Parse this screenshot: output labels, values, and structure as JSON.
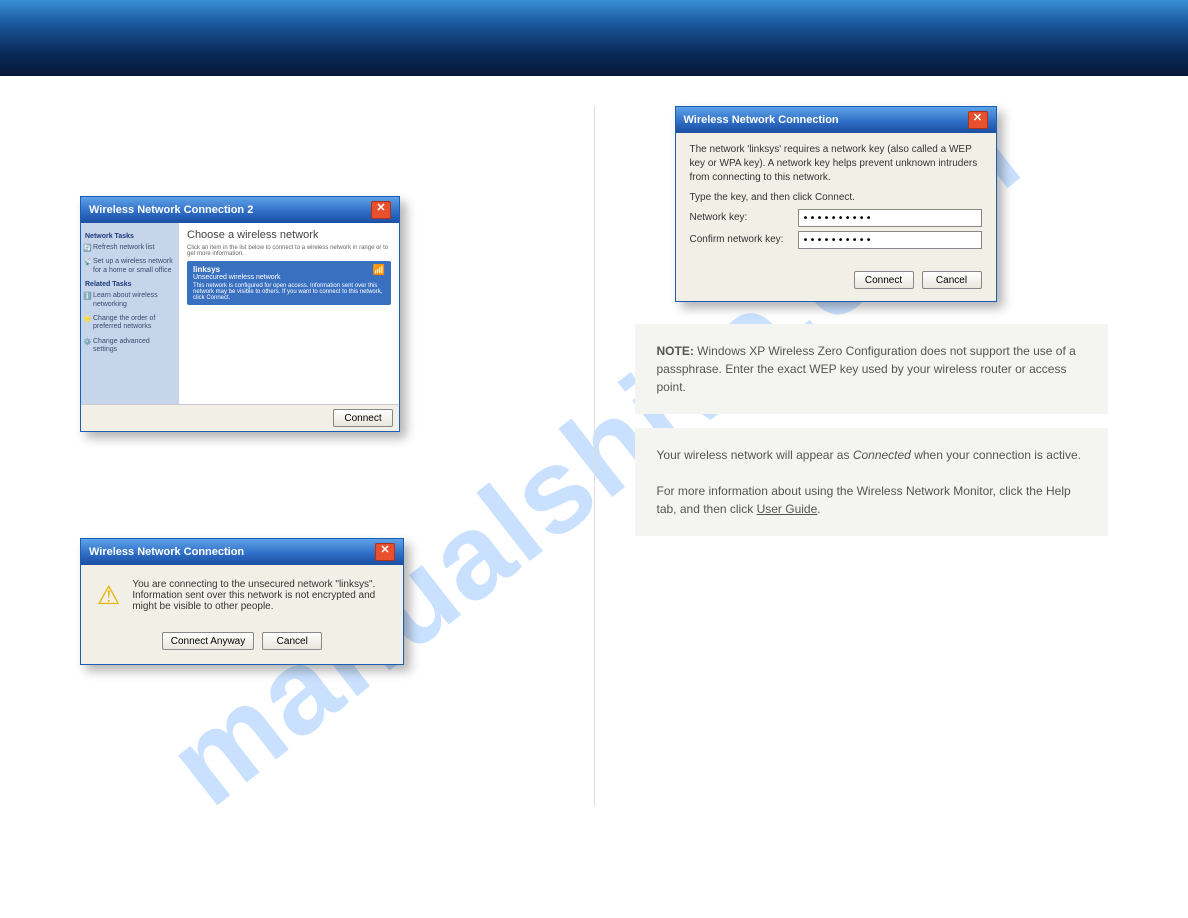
{
  "watermark": "manualshive.com",
  "chooser": {
    "title": "Wireless Network Connection 2",
    "side": {
      "heading1": "Network Tasks",
      "refresh": "Refresh network list",
      "setup": "Set up a wireless network for a home or small office",
      "heading2": "Related Tasks",
      "learn": "Learn about wireless networking",
      "order": "Change the order of preferred networks",
      "advanced": "Change advanced settings"
    },
    "main": {
      "heading": "Choose a wireless network",
      "sub": "Click an item in the list below to connect to a wireless network in range or to get more information.",
      "net_name": "linksys",
      "net_status": "Unsecured wireless network",
      "net_desc": "This network is configured for open access. Information sent over this network may be visible to others. If you want to connect to this network, click Connect.",
      "connect": "Connect"
    }
  },
  "warn": {
    "title": "Wireless Network Connection",
    "message": "You are connecting to the unsecured network \"linksys\". Information sent over this network is not encrypted and might be visible to other people.",
    "connect_anyway": "Connect Anyway",
    "cancel": "Cancel"
  },
  "key": {
    "title": "Wireless Network Connection",
    "desc": "The network 'linksys' requires a network key (also called a WEP key or WPA key). A network key helps prevent unknown intruders from connecting to this network.",
    "type_key": "Type the key, and then click Connect.",
    "label_key": "Network key:",
    "label_confirm": "Confirm network key:",
    "value": "••••••••••",
    "connect": "Connect",
    "cancel": "Cancel"
  },
  "note1": {
    "bold": "NOTE:",
    "text": " Windows XP Wireless Zero Configuration does not support the use of a passphrase. Enter the exact WEP key used by your wireless router or access point."
  },
  "note2": {
    "prefix": "Your wireless network will appear as ",
    "ital": "Connected",
    "suffix": " when your connection is active.",
    "more": "For more information about using the Wireless Network Monitor, click the Help tab, and then click ",
    "link": "User Guide"
  }
}
